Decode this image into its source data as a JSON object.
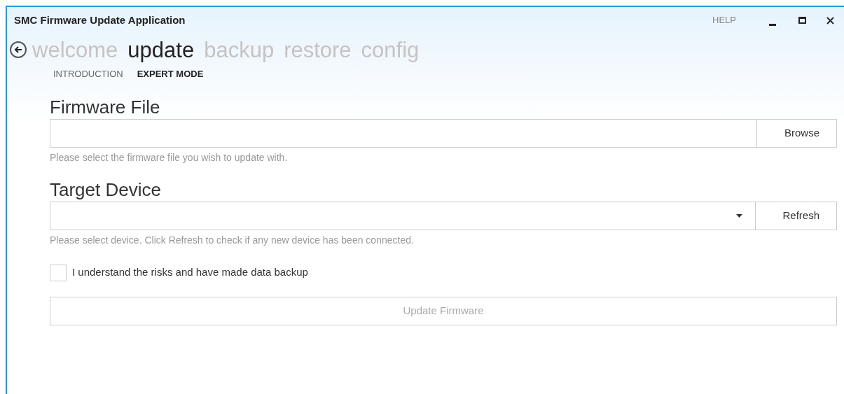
{
  "window": {
    "title": "SMC Firmware Update Application",
    "help": "HELP"
  },
  "nav": [
    {
      "label": "welcome",
      "selected": false
    },
    {
      "label": "update",
      "selected": true
    },
    {
      "label": "backup",
      "selected": false
    },
    {
      "label": "restore",
      "selected": false
    },
    {
      "label": "config",
      "selected": false
    }
  ],
  "subnav": [
    {
      "label": "INTRODUCTION",
      "selected": false
    },
    {
      "label": "EXPERT MODE",
      "selected": true
    }
  ],
  "firmware_file": {
    "heading": "Firmware File",
    "button": "Browse",
    "hint": "Please select the firmware file you wish to update with."
  },
  "target_device": {
    "heading": "Target Device",
    "button": "Refresh",
    "hint": "Please select device. Click Refresh to check if any new device has been connected."
  },
  "consent": {
    "label": "I understand the risks and have made data backup",
    "checked": false
  },
  "update_button": {
    "label": "Update Firmware",
    "disabled": true
  }
}
